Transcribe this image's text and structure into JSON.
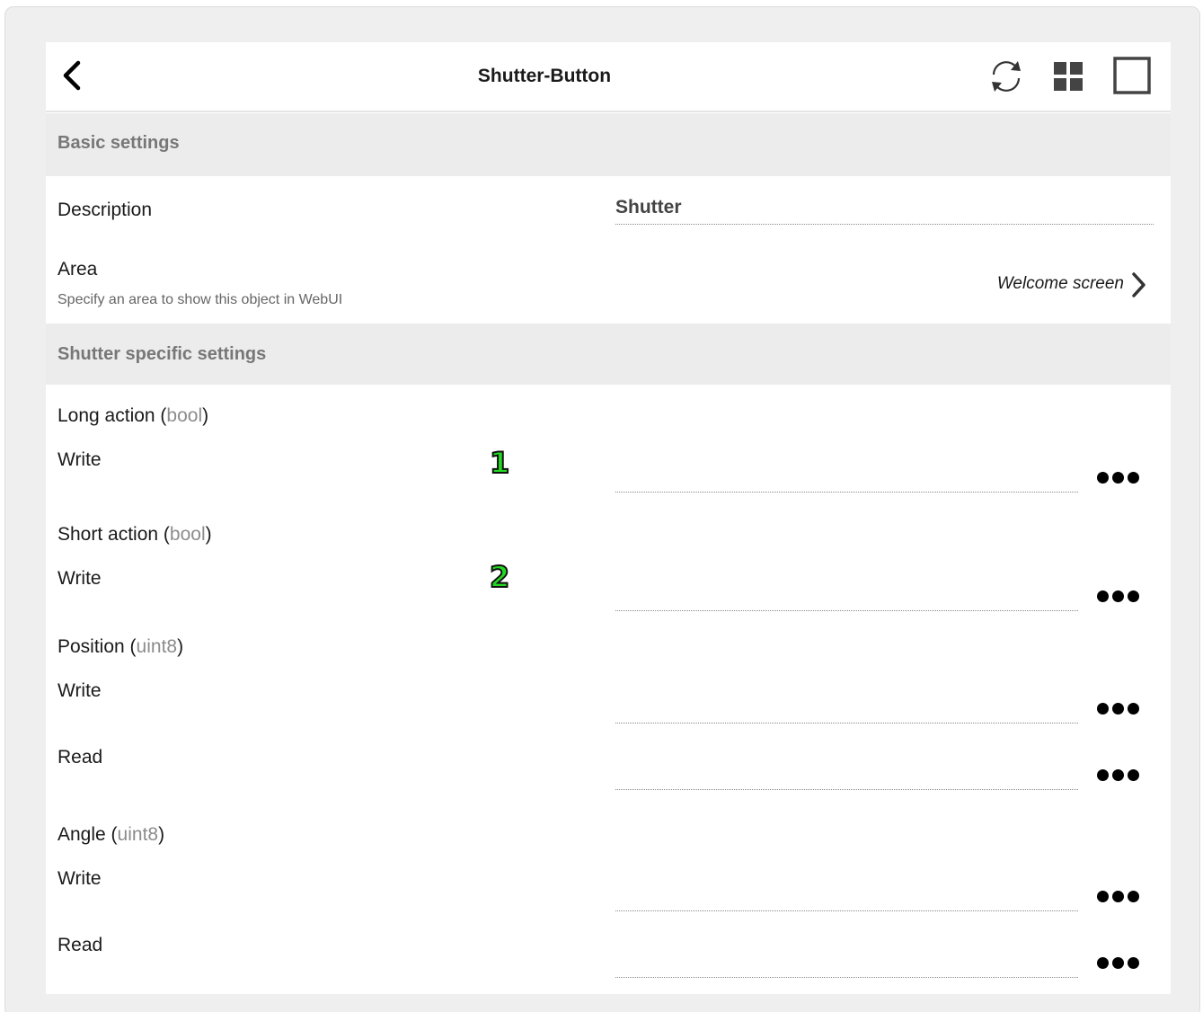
{
  "header": {
    "title": "Shutter-Button",
    "back_icon": "chevron-left-icon",
    "refresh_icon": "refresh-icon",
    "grid_icon": "grid-icon",
    "fullscreen_icon": "fullscreen-icon"
  },
  "basic": {
    "section_title": "Basic settings",
    "description_label": "Description",
    "description_value": "Shutter",
    "area_label": "Area",
    "area_hint": "Specify an area to show this object in WebUI",
    "area_value": "Welcome screen"
  },
  "shutter": {
    "section_title": "Shutter specific settings",
    "long_action": {
      "name": "Long action",
      "type": "bool",
      "write_label": "Write"
    },
    "short_action": {
      "name": "Short action",
      "type": "bool",
      "write_label": "Write"
    },
    "position": {
      "name": "Position",
      "type": "uint8",
      "write_label": "Write",
      "read_label": "Read"
    },
    "angle": {
      "name": "Angle",
      "type": "uint8",
      "write_label": "Write",
      "read_label": "Read"
    }
  },
  "markers": [
    "1",
    "2"
  ],
  "colors": {
    "section_bg": "#ececec",
    "section_text": "#777777",
    "marker_fill": "#22d822",
    "type_hint": "#8c8c8c"
  }
}
